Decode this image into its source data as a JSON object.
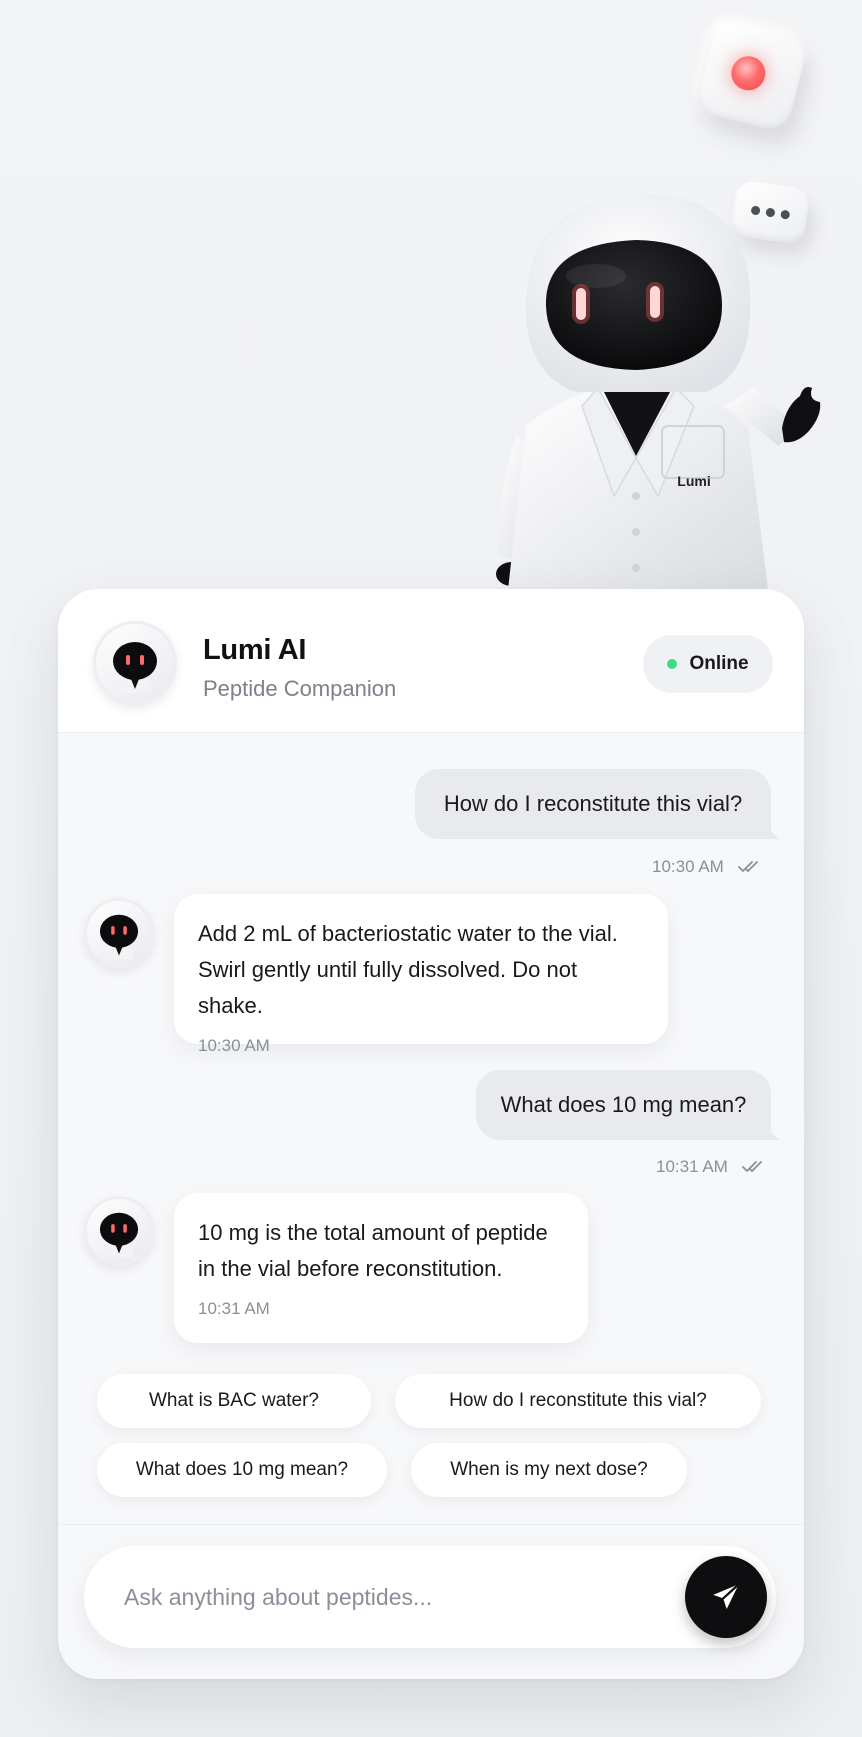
{
  "mascot": {
    "coat_label": "Lumi"
  },
  "header": {
    "title": "Lumi AI",
    "subtitle": "Peptide Companion",
    "status": "Online"
  },
  "messages": [
    {
      "from": "user",
      "text": "How do I reconstitute this vial?",
      "time": "10:30 AM"
    },
    {
      "from": "bot",
      "lines": [
        "Add 2 mL of bacteriostatic water to the vial.",
        "Swirl gently until fully dissolved. Do not shake."
      ],
      "time": "10:30 AM"
    },
    {
      "from": "user",
      "text": "What does 10 mg mean?",
      "time": "10:31 AM"
    },
    {
      "from": "bot",
      "lines": [
        "10 mg is the total amount of peptide",
        "in the vial before reconstitution."
      ],
      "time": "10:31 AM"
    }
  ],
  "suggestions": [
    "What is BAC water?",
    "How do I reconstitute this vial?",
    "What does 10 mg mean?",
    "When is my next dose?"
  ],
  "composer": {
    "placeholder": "Ask anything about peptides..."
  },
  "colors": {
    "status_online": "#3ddc84",
    "send_button": "#0e0e10",
    "eye_glow": "#ff5a5a"
  },
  "icons": {
    "send": "paper-plane-icon",
    "read_receipt": "double-check-icon",
    "recording": "record-dot-icon",
    "typing": "typing-dots-icon"
  }
}
